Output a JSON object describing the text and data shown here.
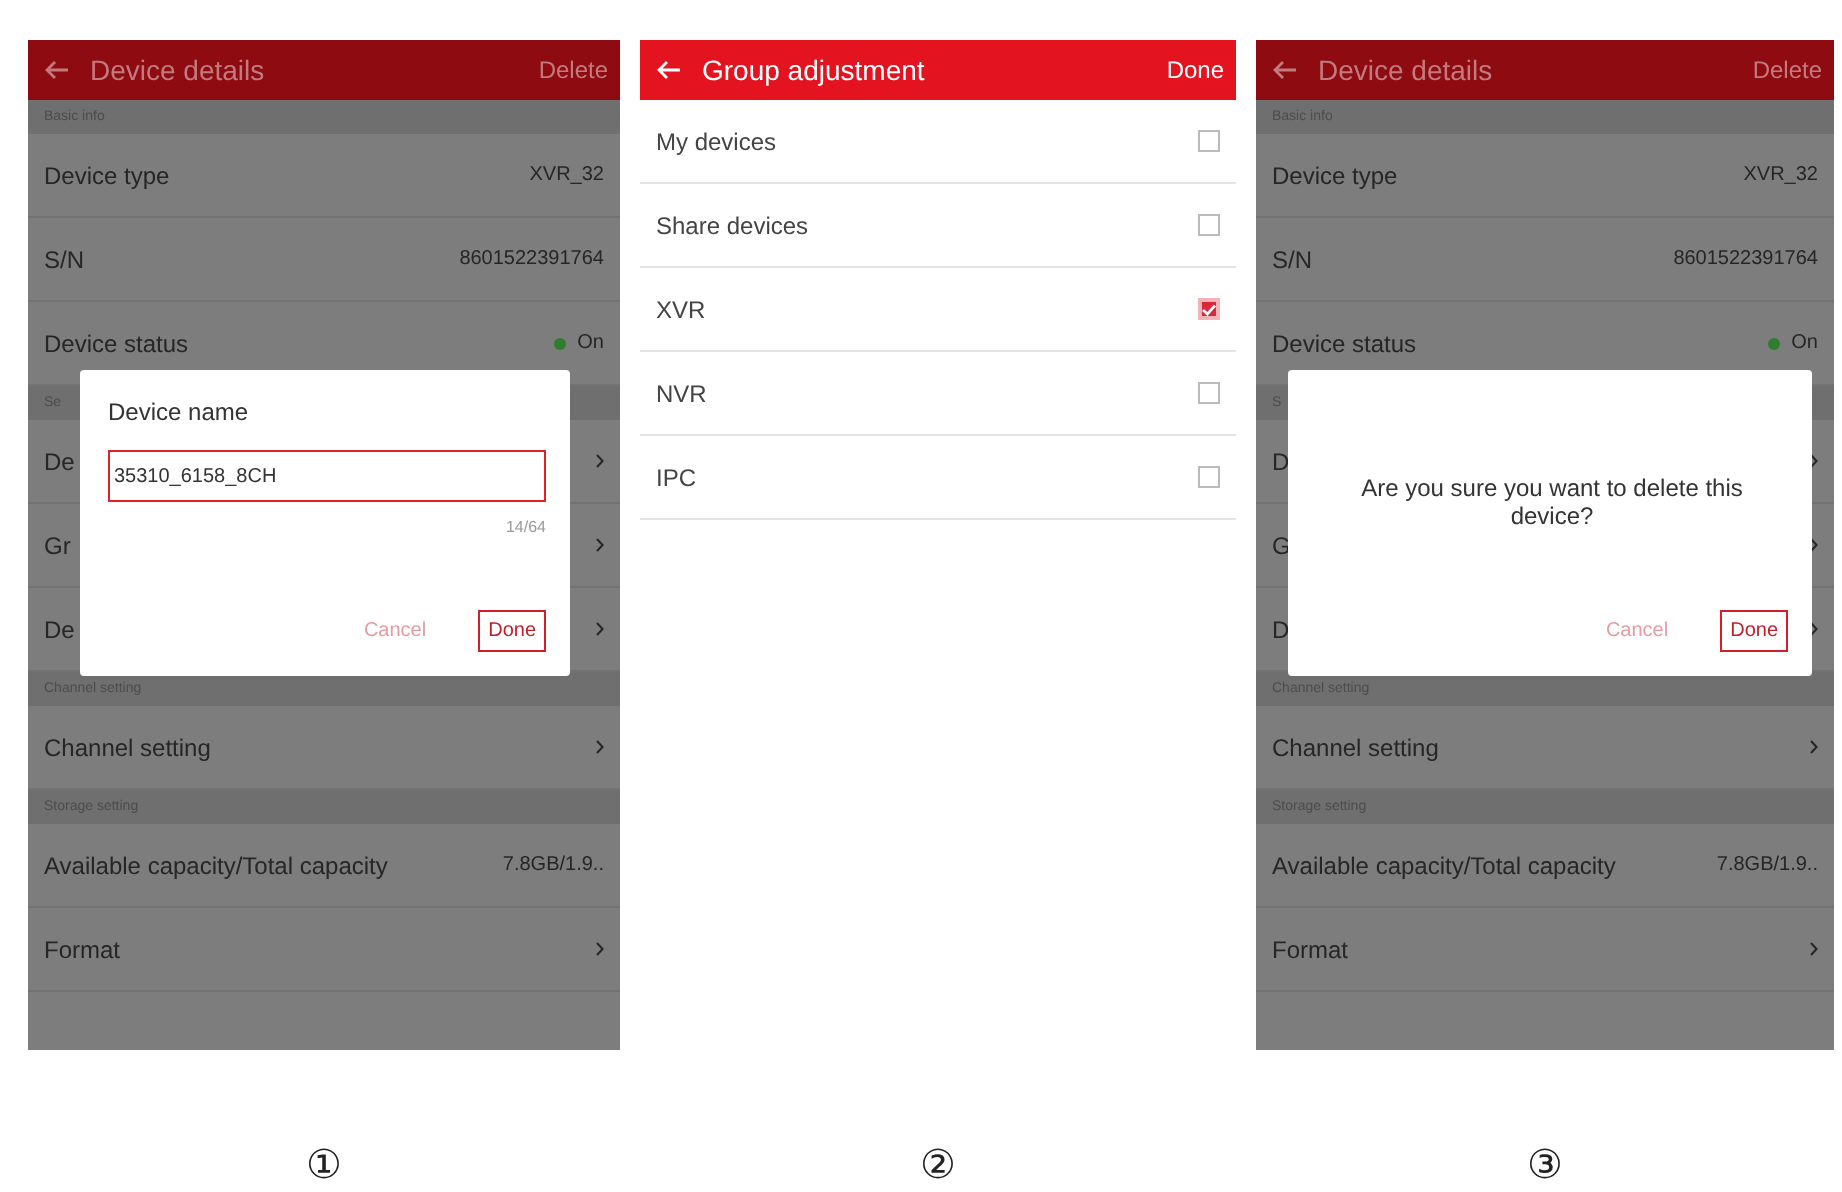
{
  "screens": [
    {
      "kind": "details",
      "title": "Device details",
      "action": "Delete",
      "dimmed": true,
      "items": [
        {
          "kind": "section",
          "label": "Basic info"
        },
        {
          "kind": "row",
          "label": "Device type",
          "value": "XVR_32",
          "chevron": false
        },
        {
          "kind": "row",
          "label": "S/N",
          "value": "8601522391764",
          "chevron": false
        },
        {
          "kind": "status",
          "label": "Device status",
          "value": "On",
          "chevron": false
        },
        {
          "kind": "section",
          "label": "Se"
        },
        {
          "kind": "row",
          "label": "De",
          "chevron": true
        },
        {
          "kind": "row",
          "label": "Gr",
          "chevron": true
        },
        {
          "kind": "row",
          "label": "De",
          "chevron": true
        },
        {
          "kind": "section",
          "label": "Channel setting"
        },
        {
          "kind": "row",
          "label": "Channel setting",
          "chevron": true
        },
        {
          "kind": "section",
          "label": "Storage setting"
        },
        {
          "kind": "row",
          "label": "Available capacity/Total capacity",
          "value": "7.8GB/1.9..",
          "chevron": false
        },
        {
          "kind": "row",
          "label": "Format",
          "chevron": true
        }
      ],
      "dialog": {
        "kind": "rename",
        "title": "Device name",
        "value": "35310_6158_8CH",
        "counter": "14/64",
        "cancel": "Cancel",
        "confirm": "Done"
      }
    },
    {
      "kind": "groups",
      "title": "Group adjustment",
      "action": "Done",
      "dimmed": false,
      "options": [
        {
          "label": "My devices",
          "checked": false
        },
        {
          "label": "Share devices",
          "checked": false
        },
        {
          "label": "XVR",
          "checked": true
        },
        {
          "label": "NVR",
          "checked": false
        },
        {
          "label": "IPC",
          "checked": false
        }
      ]
    },
    {
      "kind": "details",
      "title": "Device details",
      "action": "Delete",
      "dimmed": true,
      "items": [
        {
          "kind": "section",
          "label": "Basic info"
        },
        {
          "kind": "row",
          "label": "Device type",
          "value": "XVR_32",
          "chevron": false
        },
        {
          "kind": "row",
          "label": "S/N",
          "value": "8601522391764",
          "chevron": false
        },
        {
          "kind": "status",
          "label": "Device status",
          "value": "On",
          "chevron": false
        },
        {
          "kind": "section",
          "label": "S"
        },
        {
          "kind": "row",
          "label": "D",
          "chevron": true
        },
        {
          "kind": "row",
          "label": "G",
          "chevron": true
        },
        {
          "kind": "row",
          "label": "D",
          "chevron": true
        },
        {
          "kind": "section",
          "label": "Channel setting"
        },
        {
          "kind": "row",
          "label": "Channel setting",
          "chevron": true
        },
        {
          "kind": "section",
          "label": "Storage setting"
        },
        {
          "kind": "row",
          "label": "Available capacity/Total capacity",
          "value": "7.8GB/1.9..",
          "chevron": false
        },
        {
          "kind": "row",
          "label": "Format",
          "chevron": true
        }
      ],
      "dialog": {
        "kind": "confirm",
        "message": "Are you sure you want to delete this device?",
        "cancel": "Cancel",
        "confirm": "Done"
      }
    }
  ],
  "captions": [
    "①",
    "②",
    "③"
  ]
}
